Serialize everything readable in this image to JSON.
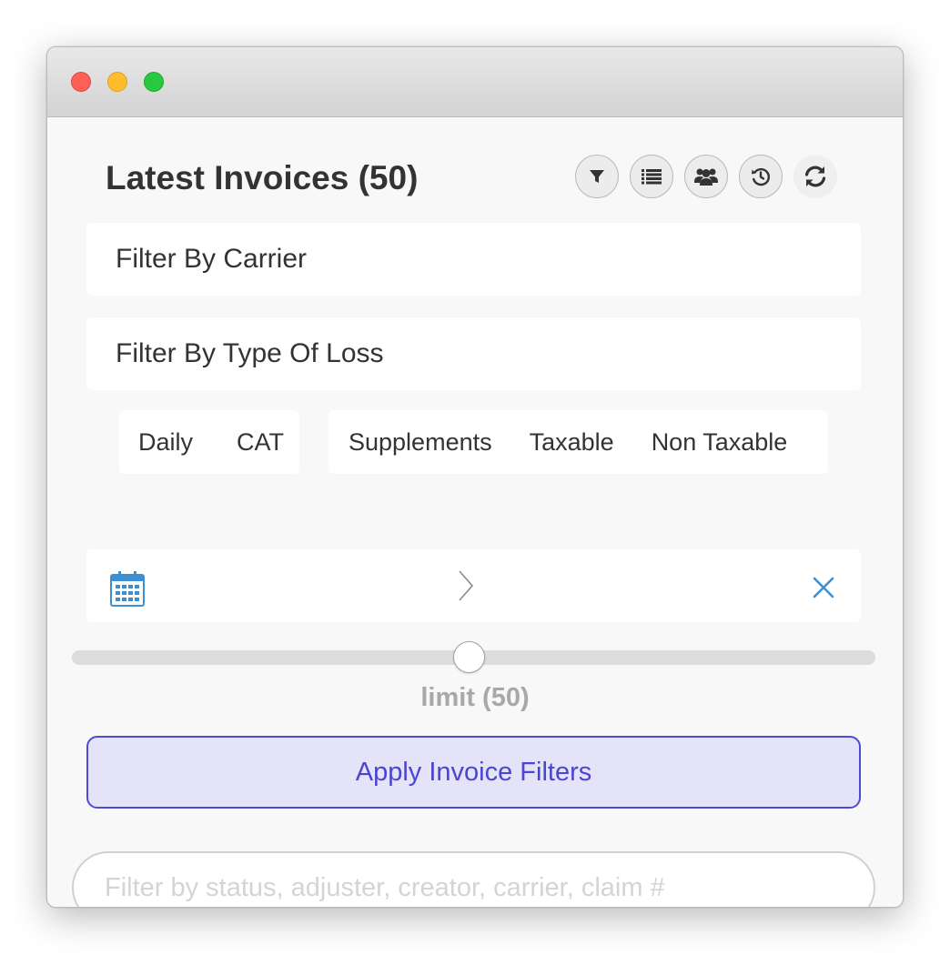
{
  "header": {
    "title": "Latest Invoices (50)",
    "tools": [
      {
        "icon": "filter-icon"
      },
      {
        "icon": "list-icon"
      },
      {
        "icon": "users-icon"
      },
      {
        "icon": "history-icon"
      },
      {
        "icon": "refresh-icon"
      }
    ]
  },
  "filters": {
    "carrier_placeholder": "Filter By Carrier",
    "loss_type_placeholder": "Filter By Type Of Loss"
  },
  "segments": {
    "group1": [
      "Daily",
      "CAT"
    ],
    "group2": [
      "Supplements",
      "Taxable",
      "Non Taxable"
    ]
  },
  "date_range": {
    "start_icon": "calendar-icon",
    "separator_icon": "chevron-right-icon",
    "clear_icon": "close-icon"
  },
  "limit": {
    "label": "limit (50)",
    "value": 50,
    "slider_fraction": 0.5
  },
  "apply_button": {
    "label": "Apply Invoice Filters"
  },
  "search": {
    "placeholder": "Filter by status, adjuster, creator, carrier, claim #",
    "value": ""
  },
  "colors": {
    "accent": "#4b45d2",
    "accent_bg": "#e4e3f7",
    "clear_icon": "#3d8fd1",
    "title": "#333333",
    "muted": "#a8a8a8"
  }
}
